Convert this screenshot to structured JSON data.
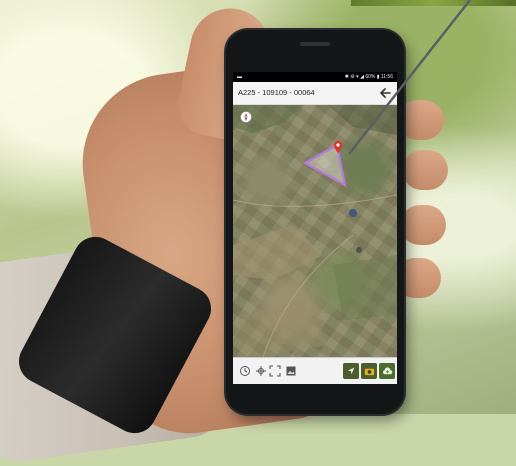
{
  "status_bar": {
    "left": "▬",
    "right": "✱ ⚙ ▾ ◢ 60% ▮ 11:56"
  },
  "app_header": {
    "title": "A225 - 109109 - 00064",
    "back_icon": "arrow-left-icon"
  },
  "map": {
    "view": "satellite",
    "compass_icon": "compass-icon",
    "parcel_outline_color": "#b57ad9",
    "marker_color": "#e0342b"
  },
  "toolbar": {
    "tools": [
      "measure-icon",
      "move-icon",
      "fullscreen-icon",
      "layers-icon"
    ],
    "actions": [
      {
        "name": "navigate-button",
        "icon": "navigation-arrow-icon",
        "color": "#4b5d2a"
      },
      {
        "name": "camera-button",
        "icon": "camera-icon",
        "color": "#e0b21c"
      },
      {
        "name": "upload-button",
        "icon": "cloud-upload-icon",
        "color": "#4e6b2e"
      }
    ]
  }
}
